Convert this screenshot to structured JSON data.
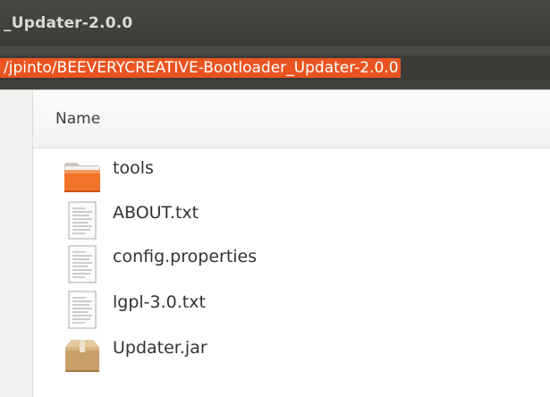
{
  "window": {
    "title": "_Updater-2.0.0"
  },
  "path_bar": {
    "value": "/jpinto/BEEVERYCREATIVE-Bootloader_Updater-2.0.0"
  },
  "file_list": {
    "column_header": "Name",
    "items": [
      {
        "name": "tools",
        "icon": "folder-icon"
      },
      {
        "name": "ABOUT.txt",
        "icon": "text-file-icon"
      },
      {
        "name": "config.properties",
        "icon": "text-file-icon"
      },
      {
        "name": "lgpl-3.0.txt",
        "icon": "text-file-icon"
      },
      {
        "name": "Updater.jar",
        "icon": "package-icon"
      }
    ]
  },
  "colors": {
    "selection": "#e95420",
    "titlebar": "#3c3b37",
    "folder": "#f37329"
  }
}
